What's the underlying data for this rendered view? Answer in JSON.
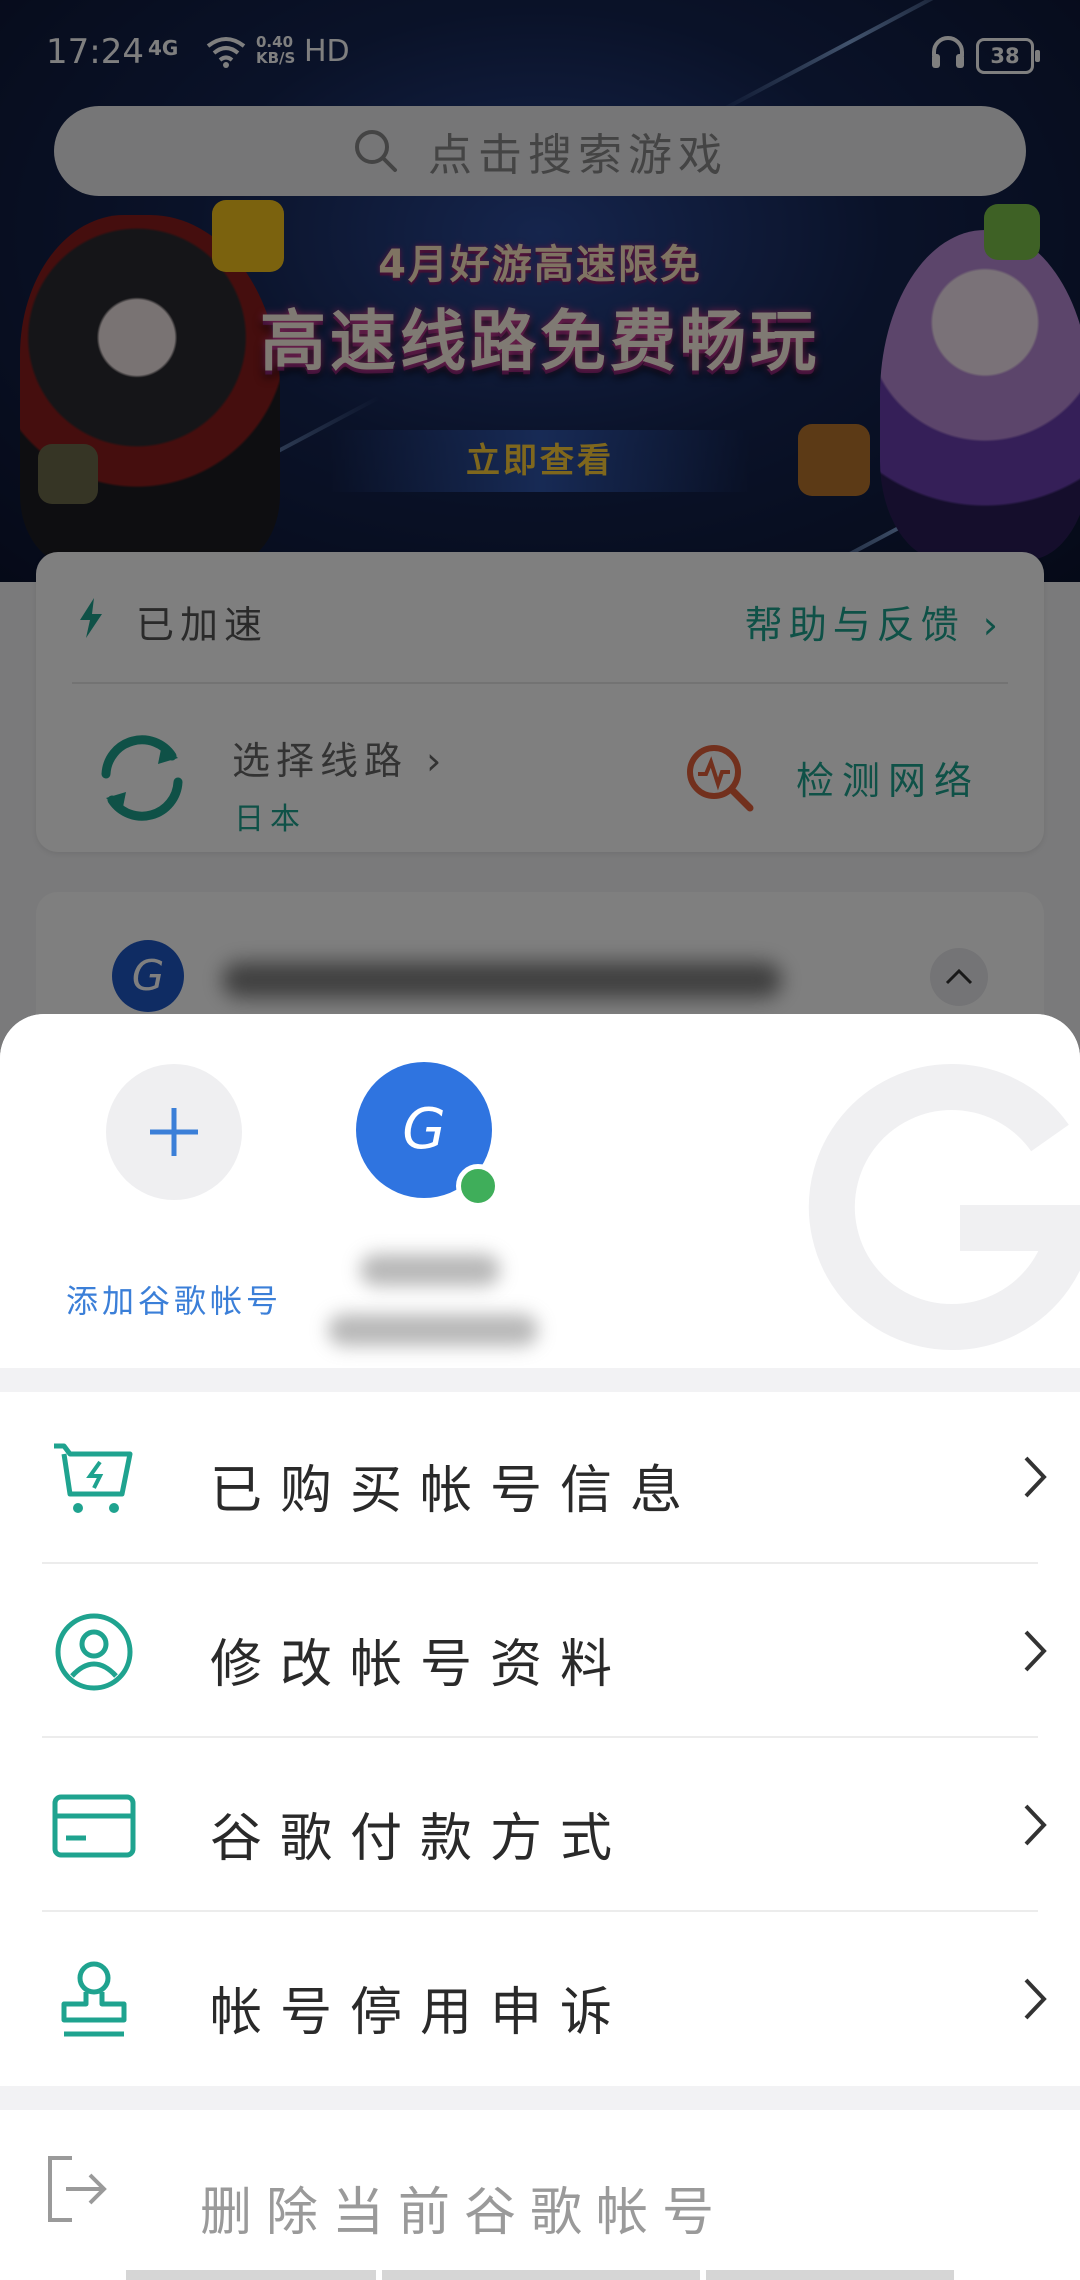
{
  "status_bar": {
    "time": "17:24",
    "network": "4G",
    "speed_value": "0.40",
    "speed_unit": "KB/S",
    "hd": "HD",
    "battery": "38"
  },
  "search": {
    "placeholder": "点击搜索游戏"
  },
  "banner": {
    "subtitle": "4月好游高速限免",
    "title": "高速线路免费畅玩",
    "cta": "立即查看"
  },
  "accel_card": {
    "status": "已加速",
    "help": "帮助与反馈",
    "route_label": "选择线路",
    "route_value": "日本",
    "detect": "检测网络"
  },
  "account_card": {
    "avatar_letter": "G"
  },
  "sheet": {
    "add_account_label": "添加谷歌帐号",
    "current_account_letter": "G",
    "menu": [
      {
        "label": "已购买帐号信息",
        "icon": "cart-icon"
      },
      {
        "label": "修改帐号资料",
        "icon": "user-icon"
      },
      {
        "label": "谷歌付款方式",
        "icon": "credit-card-icon"
      },
      {
        "label": "帐号停用申诉",
        "icon": "stamp-icon"
      }
    ],
    "delete_label": "删除当前谷歌帐号"
  },
  "colors": {
    "accent_teal": "#1fa38f",
    "google_blue": "#2f74e0",
    "online_green": "#3fae5a",
    "detect_orange": "#e4603a"
  }
}
